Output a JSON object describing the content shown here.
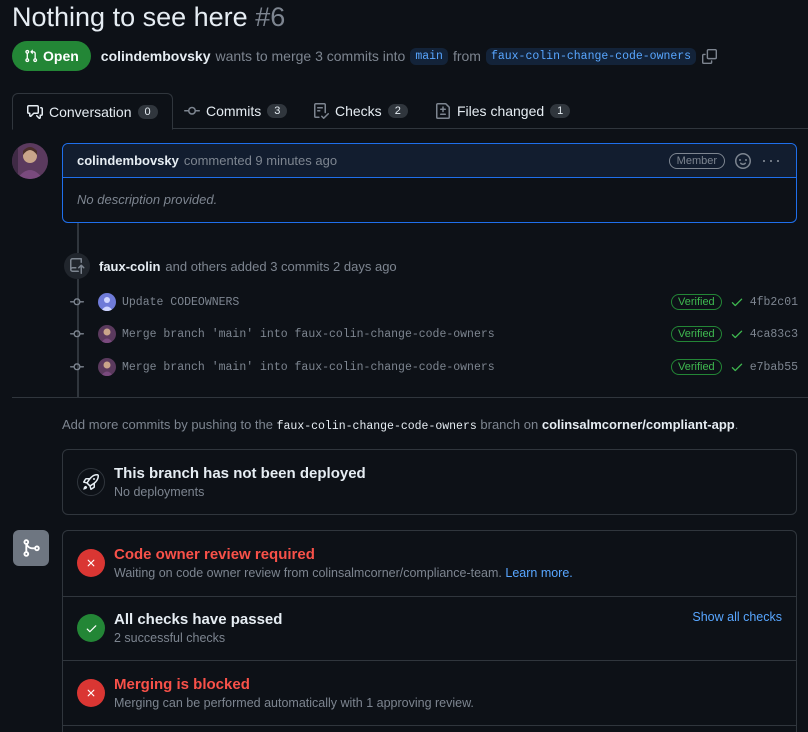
{
  "pr": {
    "title": "Nothing to see here",
    "number": "#6",
    "state": "Open",
    "author": "colindembovsky",
    "merge_text": "wants to merge 3 commits into",
    "base_branch": "main",
    "from_text": "from",
    "head_branch": "faux-colin-change-code-owners"
  },
  "tabs": [
    {
      "label": "Conversation",
      "count": "0"
    },
    {
      "label": "Commits",
      "count": "3"
    },
    {
      "label": "Checks",
      "count": "2"
    },
    {
      "label": "Files changed",
      "count": "1"
    }
  ],
  "comment": {
    "author": "colindembovsky",
    "time": "commented 9 minutes ago",
    "role": "Member",
    "body": "No description provided."
  },
  "push_event": {
    "author": "faux-colin",
    "text": "and others added 3 commits 2 days ago"
  },
  "commits": [
    {
      "message": "Update CODEOWNERS",
      "badge": "Verified",
      "sha": "4fb2c01"
    },
    {
      "message": "Merge branch 'main' into faux-colin-change-code-owners",
      "badge": "Verified",
      "sha": "4ca83c3"
    },
    {
      "message": "Merge branch 'main' into faux-colin-change-code-owners",
      "badge": "Verified",
      "sha": "e7bab55"
    }
  ],
  "add_more": {
    "prefix": "Add more commits by pushing to the",
    "branch": "faux-colin-change-code-owners",
    "middle": "branch on",
    "repo": "colinsalmcorner/compliant-app",
    "suffix": "."
  },
  "deployment": {
    "title": "This branch has not been deployed",
    "subtitle": "No deployments"
  },
  "merge_status": {
    "review": {
      "title": "Code owner review required",
      "subtitle": "Waiting on code owner review from colinsalmcorner/compliance-team.",
      "link": "Learn more."
    },
    "checks": {
      "title": "All checks have passed",
      "subtitle": "2 successful checks",
      "action": "Show all checks"
    },
    "blocked": {
      "title": "Merging is blocked",
      "subtitle": "Merging can be performed automatically with 1 approving review."
    }
  },
  "colors": {
    "open_green": "#238636",
    "link_blue": "#58a6ff",
    "danger_red": "#f85149",
    "background": "#0d1117"
  }
}
